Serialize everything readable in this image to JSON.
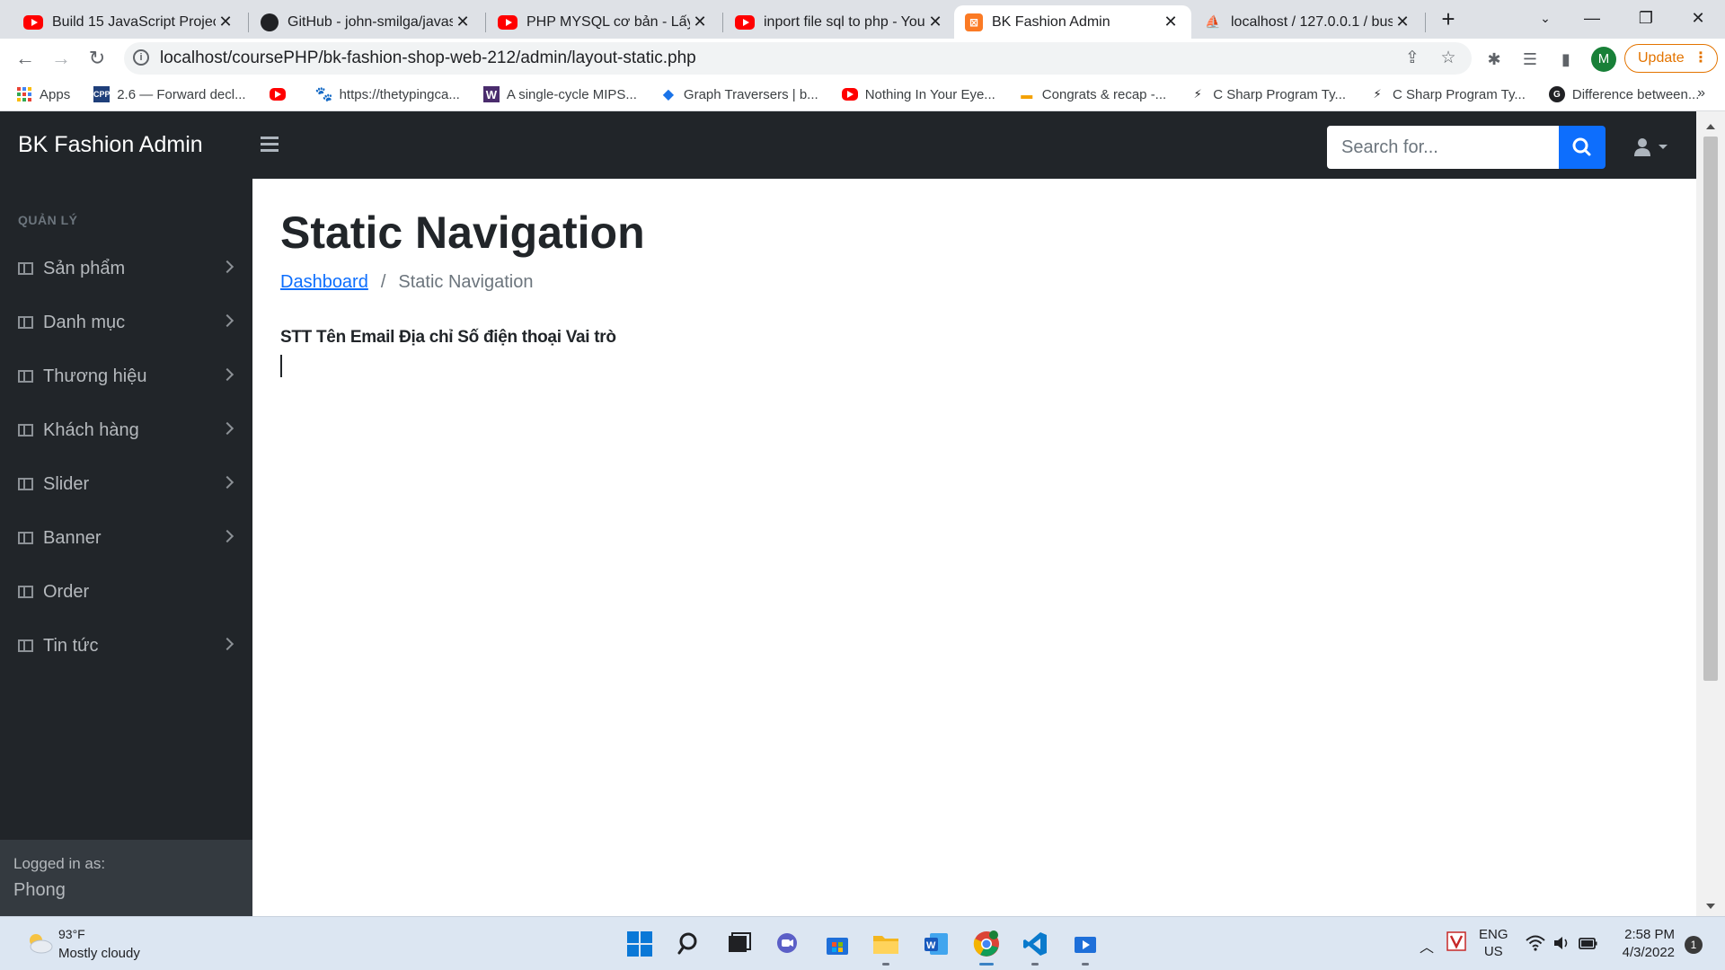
{
  "browser": {
    "tabs": [
      {
        "title": "Build 15 JavaScript Projects",
        "favicon": "youtube-icon",
        "active": false
      },
      {
        "title": "GitHub - john-smilga/javasc",
        "favicon": "github-icon",
        "active": false
      },
      {
        "title": "PHP MYSQL cơ bản - Lấy dữ",
        "favicon": "youtube-icon",
        "active": false
      },
      {
        "title": "inport file sql to php - YouT",
        "favicon": "youtube-icon",
        "active": false
      },
      {
        "title": "BK Fashion Admin",
        "favicon": "xampp-icon",
        "active": true
      },
      {
        "title": "localhost / 127.0.0.1 / busin",
        "favicon": "phpmyadmin-icon",
        "active": false
      }
    ],
    "url": "localhost/coursePHP/bk-fashion-shop-web-212/admin/layout-static.php",
    "profile_initial": "M",
    "update_label": "Update",
    "bookmarks": [
      {
        "label": "Apps",
        "icon": "apps-grid-icon"
      },
      {
        "label": "2.6 — Forward decl...",
        "icon": "cpp-icon"
      },
      {
        "label": "",
        "icon": "youtube-icon"
      },
      {
        "label": "https://thetypingca...",
        "icon": "paw-icon"
      },
      {
        "label": "A single-cycle MIPS...",
        "icon": "w-icon"
      },
      {
        "label": "Graph Traversers | b...",
        "icon": "diamond-icon"
      },
      {
        "label": "Nothing In Your Eye...",
        "icon": "youtube-icon"
      },
      {
        "label": "Congrats & recap -...",
        "icon": "doc-icon"
      },
      {
        "label": "C Sharp Program Ty...",
        "icon": "bolt-icon"
      },
      {
        "label": "C Sharp Program Ty...",
        "icon": "bolt-icon"
      },
      {
        "label": "Difference between...",
        "icon": "g-icon"
      }
    ],
    "bookmarks_more": "»"
  },
  "app": {
    "brand": "BK Fashion Admin",
    "search_placeholder": "Search for...",
    "sidebar": {
      "heading": "QUẢN LÝ",
      "items": [
        {
          "label": "Sản phẩm",
          "has_submenu": true
        },
        {
          "label": "Danh mục",
          "has_submenu": true
        },
        {
          "label": "Thương hiệu",
          "has_submenu": true
        },
        {
          "label": "Khách hàng",
          "has_submenu": true
        },
        {
          "label": "Slider",
          "has_submenu": true
        },
        {
          "label": "Banner",
          "has_submenu": true
        },
        {
          "label": "Order",
          "has_submenu": false
        },
        {
          "label": "Tin tức",
          "has_submenu": true
        }
      ],
      "footer_label": "Logged in as:",
      "footer_user": "Phong"
    },
    "main": {
      "title": "Static Navigation",
      "breadcrumb": [
        "Dashboard",
        "Static Navigation"
      ],
      "breadcrumb_sep": "/",
      "table_headers": [
        "STT",
        "Tên",
        "Email",
        "Địa chỉ",
        "Số điện thoại",
        "Vai trò"
      ]
    }
  },
  "taskbar": {
    "weather_temp": "93°F",
    "weather_desc": "Mostly cloudy",
    "lang_line1": "ENG",
    "lang_line2": "US",
    "time": "2:58 PM",
    "date": "4/3/2022",
    "notifications": "1"
  },
  "colors": {
    "navbar": "#212529",
    "accent": "#0d6efd",
    "sidebar_footer": "#343a40"
  }
}
